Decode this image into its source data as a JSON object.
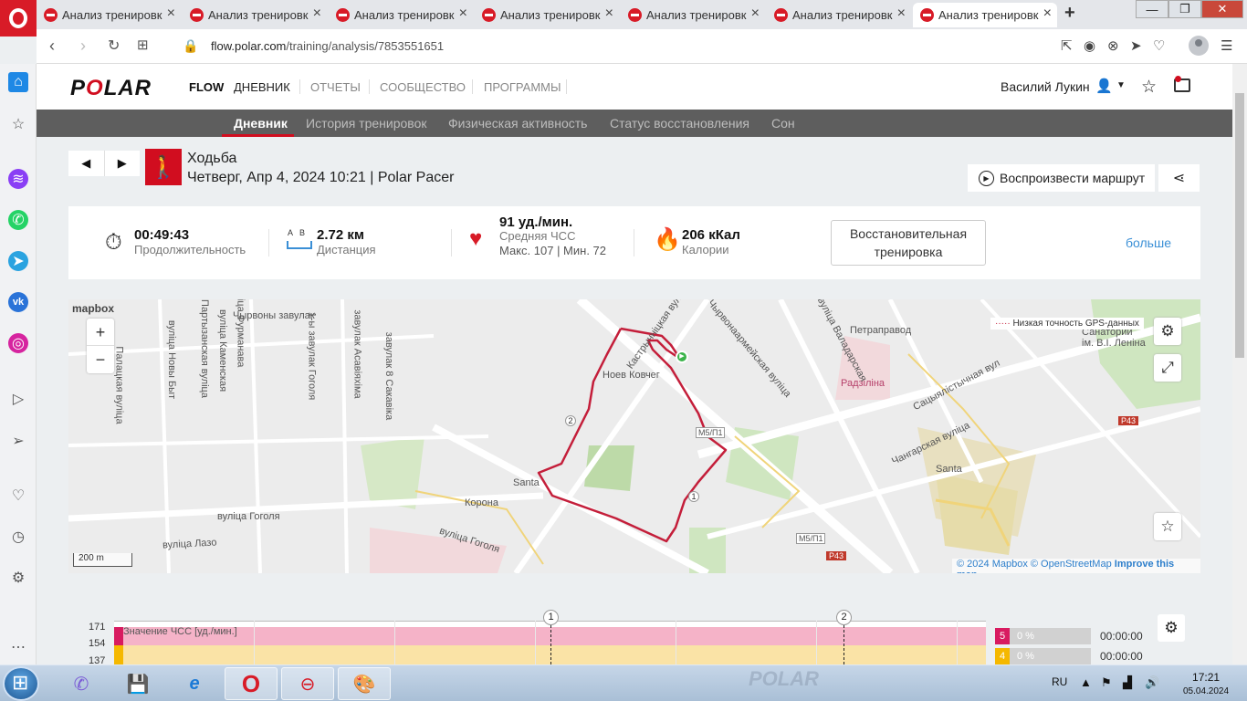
{
  "browser": {
    "tabs": [
      {
        "title": "Анализ тренировк"
      },
      {
        "title": "Анализ тренировк"
      },
      {
        "title": "Анализ тренировк"
      },
      {
        "title": "Анализ тренировк"
      },
      {
        "title": "Анализ тренировк"
      },
      {
        "title": "Анализ тренировк"
      },
      {
        "title": "Анализ тренировк"
      }
    ],
    "active_tab": 6,
    "url_host": "flow.polar.com",
    "url_path": "/training/analysis/7853551651"
  },
  "topnav": {
    "logo": "POLAR",
    "flow": "FLOW",
    "items": [
      "ДНЕВНИК",
      "ОТЧЕТЫ",
      "СООБЩЕСТВО",
      "ПРОГРАММЫ"
    ],
    "active": "ДНЕВНИК",
    "user_name": "Василий Лукин"
  },
  "subnav": {
    "items": [
      "Дневник",
      "История тренировок",
      "Физическая активность",
      "Статус восстановления",
      "Сон"
    ],
    "active": "Дневник"
  },
  "session": {
    "sport": "Ходьба",
    "info": "Четверг, Апр 4, 2024 10:21 | Polar Pacer",
    "replay_label": "Воспроизвести маршрут"
  },
  "summary": {
    "duration": {
      "value": "00:49:43",
      "label": "Продолжительность"
    },
    "distance": {
      "value": "2.72 км",
      "label": "Дистанция",
      "ab": "A   B"
    },
    "hr": {
      "value": "91 уд./мин.",
      "label": "Средняя ЧСС",
      "detail": "Макс. 107  |  Мин. 72"
    },
    "calories": {
      "value": "206 кКал",
      "label": "Калории"
    },
    "training_benefit": "Восстановительная тренировка",
    "more": "больше"
  },
  "map": {
    "brand": "mapbox",
    "zoom_in": "+",
    "zoom_out": "−",
    "gps_legend": "Низкая точность GPS-данных",
    "scale": "200 m",
    "attribution_copy": "© 2024 Mapbox © OpenStreetMap",
    "attribution_link": "Improve this map",
    "labels": [
      "вуліца Чырвоны завулак",
      "Чырвоны завулак",
      "завулак 8 Сакавіка",
      "вуліца Фурманава",
      "Партызанская вуліца",
      "вуліца Каменская",
      "вуліца Новы Быт",
      "Палацкая вуліца",
      "1-ы завулак Гоголя",
      "завулак Асавіяхіма",
      "Петраправод",
      "Радзіліна",
      "Ноев Ковчег",
      "Чырвонаармейская вуліца",
      "вуліца Валадарская",
      "Сацыялістычная вул",
      "Чангарская вуліца",
      "Santa",
      "Santa",
      "Корона",
      "вуліца Гоголя",
      "вуліца Лазо",
      "Кастрычніцкая вуліца",
      "M5/П1",
      "M5/П1",
      "P43",
      "P43",
      "Санаторий ім. В.І. Леніна",
      "вуліца Гоголя"
    ],
    "km_markers": [
      "1",
      "2"
    ]
  },
  "hr_chart": {
    "title": "Значение ЧСС [уд./мин.]",
    "yticks": [
      "171",
      "154",
      "137"
    ],
    "laps": [
      "1",
      "2"
    ],
    "zones": [
      {
        "n": "5",
        "pct": "0 %",
        "time": "00:00:00",
        "color": "#d81b60"
      },
      {
        "n": "4",
        "pct": "0 %",
        "time": "00:00:00",
        "color": "#f5b800"
      }
    ]
  },
  "taskbar": {
    "lang": "RU",
    "time": "17:21",
    "date": "05.04.2024",
    "watermark": "POLAR"
  }
}
